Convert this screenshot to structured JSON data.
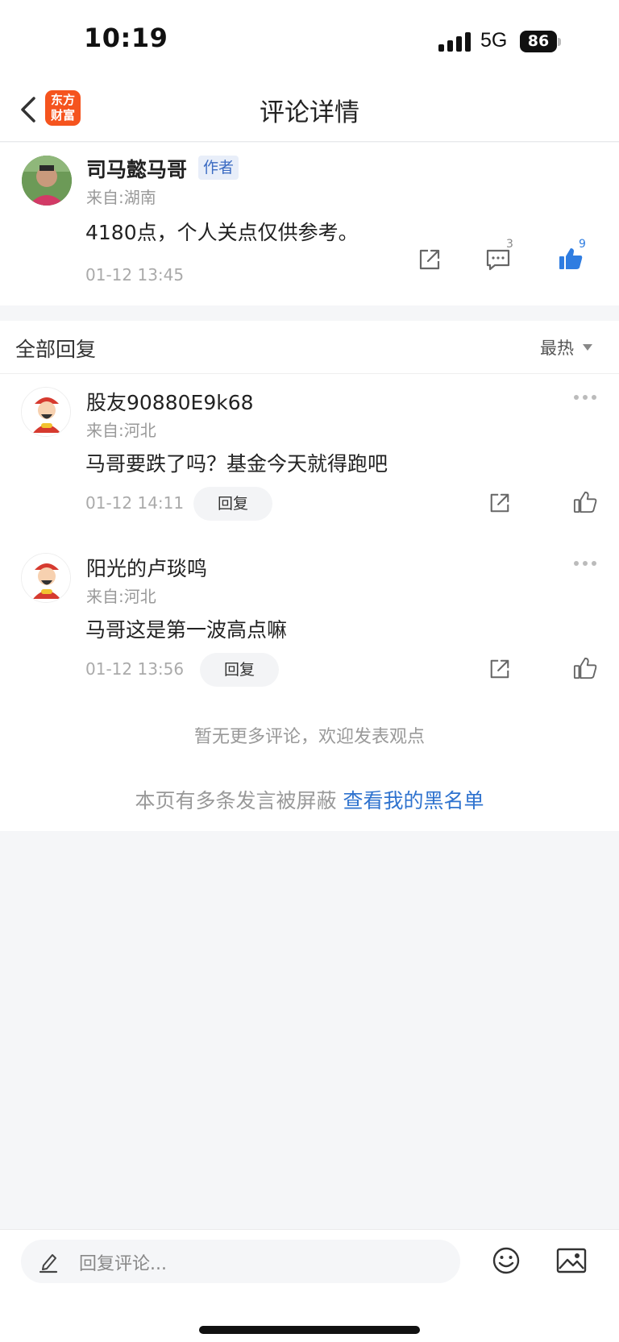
{
  "status": {
    "time": "10:19",
    "network": "5G",
    "battery": "86"
  },
  "nav": {
    "title": "评论详情",
    "logo_line1": "东方",
    "logo_line2": "财富"
  },
  "post": {
    "author": "司马懿马哥",
    "tag": "作者",
    "location": "来自:湖南",
    "content": "4180点，个人关点仅供参考。",
    "time": "01-12 13:45",
    "comment_count": "3",
    "like_count": "9"
  },
  "replies_section": {
    "title": "全部回复",
    "sort_label": "最热"
  },
  "replies": [
    {
      "name": "股友90880E9k68",
      "location": "来自:河北",
      "content": "马哥要跌了吗？基金今天就得跑吧",
      "time": "01-12 14:11",
      "reply_label": "回复"
    },
    {
      "name": "阳光的卢琰鸣",
      "location": "来自:河北",
      "content": "马哥这是第一波高点嘛",
      "time": "01-12 13:56",
      "reply_label": "回复"
    }
  ],
  "footer": {
    "no_more": "暂无更多评论，欢迎发表观点",
    "blocked_text": "本页有多条发言被屏蔽 ",
    "blocked_link": "查看我的黑名单"
  },
  "bottom": {
    "input_placeholder": "回复评论..."
  },
  "colors": {
    "accent_blue": "#2f7de1",
    "logo_orange": "#f5541e"
  },
  "icons": [
    "back-icon",
    "share-icon",
    "comment-icon",
    "like-icon",
    "more-icon",
    "pencil-icon",
    "emoji-icon",
    "image-icon"
  ]
}
